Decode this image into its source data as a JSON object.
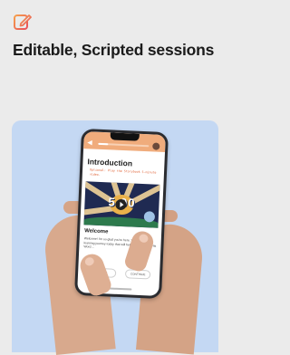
{
  "card": {
    "heading": "Editable, Scripted sessions",
    "icon": "edit-icon",
    "accent_color": "#e8505b"
  },
  "phone_screen": {
    "lesson_title": "Introduction",
    "lesson_subtitle": "Optional: Play the Storybook 5-minute video.",
    "video_text": "5:00",
    "section_title": "Welcome",
    "body_text": "Welcome! I'm so glad you're here. We'll begin the learning journey today that will help kids God and His Word ...",
    "nav_back_label": "BACK",
    "nav_next_label": "CONTINUE",
    "progress": 0.2,
    "header_color": "#f0ac7c"
  }
}
